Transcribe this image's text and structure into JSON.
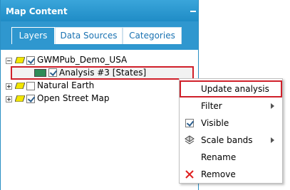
{
  "panel": {
    "title": "Map Content",
    "collapse_icon": "minimize-icon"
  },
  "tabs": [
    {
      "label": "Layers",
      "active": true
    },
    {
      "label": "Data Sources",
      "active": false
    },
    {
      "label": "Categories",
      "active": false
    }
  ],
  "tree": {
    "items": [
      {
        "label": "GWMPub_Demo_USA",
        "expanded": true,
        "checked": true
      },
      {
        "label": "Analysis #3 [States]",
        "checked": true,
        "swatch_color": "#2e8b57",
        "selected": true
      },
      {
        "label": "Natural Earth",
        "expanded": false,
        "checked": false
      },
      {
        "label": "Open Street Map",
        "expanded": false,
        "checked": true
      }
    ]
  },
  "context_menu": {
    "items": [
      {
        "label": "Update analysis",
        "highlighted": true
      },
      {
        "label": "Filter",
        "submenu": true
      },
      {
        "label": "Visible",
        "icon": "checkbox-icon",
        "checked": true
      },
      {
        "label": "Scale bands",
        "icon": "scale-bands-icon",
        "submenu": true
      },
      {
        "label": "Rename"
      },
      {
        "label": "Remove",
        "icon": "remove-x-icon",
        "icon_color": "#e02020"
      }
    ]
  },
  "colors": {
    "header_blue": "#2f97cf",
    "highlight_red": "#d0202a",
    "layer_icon_yellow": "#f2e600"
  }
}
